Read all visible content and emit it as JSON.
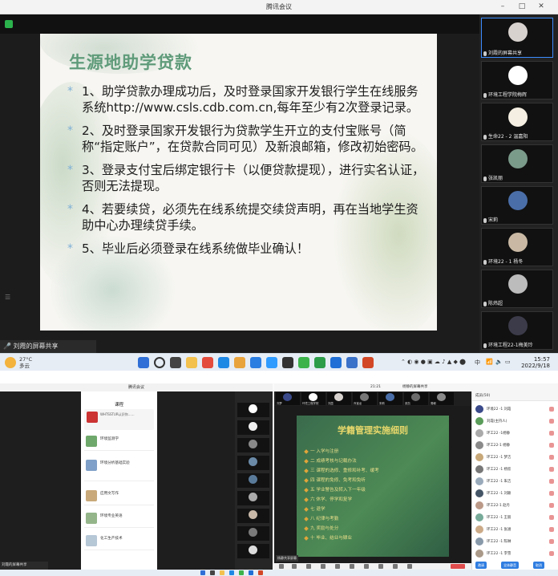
{
  "top": {
    "window_title": "腾讯会议",
    "slide": {
      "title": "生源地助学贷款",
      "bullet": "*",
      "items": [
        "1、助学贷款办理成功后，及时登录国家开发银行学生在线服务系统http://www.csls.cdb.com.cn,每年至少有2次登录记录。",
        "2、及时登录国家开发银行为贷款学生开立的支付宝账号（简称“指定账户”，在贷款合同可见）及新浪邮箱，修改初始密码。",
        "3、登录支付宝后绑定银行卡（以便贷款提现），进行实名认证，否则无法提现。",
        "4、若要续贷，必须先在线系统提交续贷声明，再在当地学生资助中心办理续贷手续。",
        "5、毕业后必须登录在线系统做毕业确认！"
      ]
    },
    "share_label": "刘霞的屏幕共享",
    "participants": [
      {
        "name": "刘霞的屏幕共享"
      },
      {
        "name": "环境工程学院梅辉"
      },
      {
        "name": "生命22 - 2 温嘉阳"
      },
      {
        "name": "张凯丽"
      },
      {
        "name": "宋莉"
      },
      {
        "name": "环境22 - 1 杨冬"
      },
      {
        "name": "陈炜超"
      },
      {
        "name": "环境工程22-1梅美玲"
      }
    ],
    "taskbar": {
      "weather_temp": "27°C",
      "weather_desc": "多云",
      "time": "15:57",
      "date": "2022/9/18",
      "lang": "中"
    }
  },
  "bottom": {
    "left_window_title": "腾讯会议",
    "phone": {
      "title": "课程",
      "hero_text": "WHTSSTUR认识你……",
      "courses": [
        {
          "name": "环境监测学",
          "sub": ""
        },
        {
          "name": "环境分析基础实验",
          "sub": ""
        },
        {
          "name": "应用文写作",
          "sub": ""
        },
        {
          "name": "环境专业英语",
          "sub": ""
        },
        {
          "name": "化工生产技术",
          "sub": ""
        }
      ]
    },
    "left_share_label": "刘霞的屏幕共享",
    "right_window": {
      "top_label": "杨静的屏幕共享",
      "top_time": "21:21",
      "thumb_names": [
        "刘梦",
        "环境工程学院",
        "刘霞",
        "乔宝龙",
        "宋莉",
        "张凯",
        "周朝"
      ],
      "slide_title": "学籍管理实施细则",
      "slide_items": [
        "一  入学与注册",
        "二  成绩考核与记载办法",
        "三  课程的选修、重修和补考、缓考",
        "四  课程的免修、免考和免听",
        "五  学业警告及转入下一年级",
        "六  休学、停学和复学",
        "七  退学",
        "八  纪律与考勤",
        "九  奖励与处分",
        "十  毕业、结业与肄业"
      ],
      "share_tag": "杨静共享屏幕",
      "list_header": "成员(50)",
      "members": [
        "环境22 -1 刘霞",
        "刘霞(主持人)",
        "环工22 -1杨静",
        "环工22-1 杨静",
        "环工22 -1 梦洁",
        "环工22 -1 杨欣",
        "环工22 -1 朱洁",
        "环工22 -1 刘颖",
        "环工22-1 赵丹",
        "环工22 -1 王丽",
        "环工22 -1 张涵",
        "环工22 -1 陈琳",
        "环工22 -1 李雪"
      ],
      "btn_invite": "邀请",
      "btn_mute": "全体静音",
      "btn_cancel": "取消"
    }
  }
}
